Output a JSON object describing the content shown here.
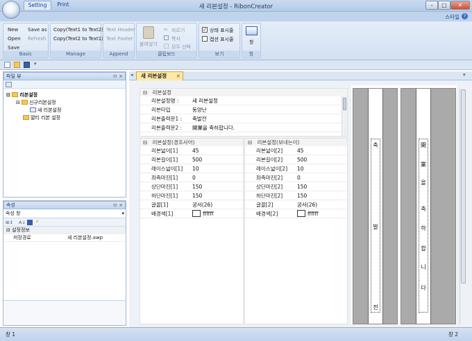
{
  "window": {
    "title": "새 리본설정 - RibonCreator"
  },
  "tabs": {
    "setting": "Setting",
    "print": "Print",
    "style": "스타일",
    "help": "?"
  },
  "ribbon": {
    "basic": {
      "label": "Basic",
      "new": "New",
      "open": "Open",
      "save": "Save",
      "save_as": "Save as",
      "refresh": "Refresh"
    },
    "manage": {
      "label": "Manage",
      "copy12": "Copy(Text1 to Text2)",
      "copy21": "Copy(Text2 to Text1)"
    },
    "append": {
      "label": "Append",
      "header": "Text Header",
      "footer": "Text Footer"
    },
    "clipboard": {
      "label": "클립보드",
      "paste": "붙여넣기",
      "cut": "자르기",
      "copy": "복사",
      "select_all": "모두 선택"
    },
    "view": {
      "label": "보기",
      "status": "상태 표시줄",
      "caption": "캡션 표시줄"
    },
    "window": {
      "label": "창",
      "btn": "창"
    }
  },
  "file_pane": {
    "title": "파일 뷰",
    "tree": {
      "root": "리본설정",
      "new_settings": "신규리본설정",
      "new_ribbon": "새 리본설정",
      "multi": "멀티 리본 설정"
    }
  },
  "props_pane": {
    "title": "속성",
    "combo": "속성 창",
    "category": "설정정보",
    "row_label": "저장경로",
    "row_value": "새 리본설정.awp"
  },
  "doc": {
    "tab": "새 리본설정",
    "close": "×",
    "sec_main": "리본설정",
    "main_rows": [
      {
        "label": "리본설정명 :",
        "value": "새 리본설정"
      },
      {
        "label": "리본타입",
        "value": "동양난"
      },
      {
        "label": "리본출력문1 :",
        "value": "축발전"
      },
      {
        "label": "리본출력문2 :",
        "value": "開業을 축하합니다."
      }
    ],
    "left_grid": {
      "head": "리본설정(경조사어)",
      "rows": [
        {
          "label": "리본넓이[1]",
          "value": "45"
        },
        {
          "label": "리본길이[1]",
          "value": "500"
        },
        {
          "label": "레이스넓이[1]",
          "value": "10"
        },
        {
          "label": "좌측마진[1]",
          "value": "0"
        },
        {
          "label": "상단마진[1]",
          "value": "150"
        },
        {
          "label": "하단마진[1]",
          "value": "150"
        },
        {
          "label": "글꼴[1]",
          "value": "궁서(26)"
        },
        {
          "label": "배경색[1]",
          "value": "ffffff"
        }
      ]
    },
    "right_grid": {
      "head": "리본설정(보내는이)",
      "rows": [
        {
          "label": "리본넓이[2]",
          "value": "45"
        },
        {
          "label": "리본길이[2]",
          "value": "500"
        },
        {
          "label": "레이스넓이[2]",
          "value": "10"
        },
        {
          "label": "좌측마진[2]",
          "value": "0"
        },
        {
          "label": "상단마진[2]",
          "value": "150"
        },
        {
          "label": "하단마진[2]",
          "value": "150"
        },
        {
          "label": "글꼴[2]",
          "value": "궁서(26)"
        },
        {
          "label": "배경색[2]",
          "value": "ffffff"
        }
      ]
    },
    "ribbon1": {
      "c1": "축",
      "c2": "발",
      "c3": "전"
    },
    "ribbon2": {
      "c1": "開",
      "c2": "業",
      "c3": "을",
      "c4": "축",
      "c5": "하",
      "c6": "합",
      "c7": "니",
      "c8": "다"
    }
  },
  "status": {
    "left": "창 1",
    "right": "창 2"
  }
}
